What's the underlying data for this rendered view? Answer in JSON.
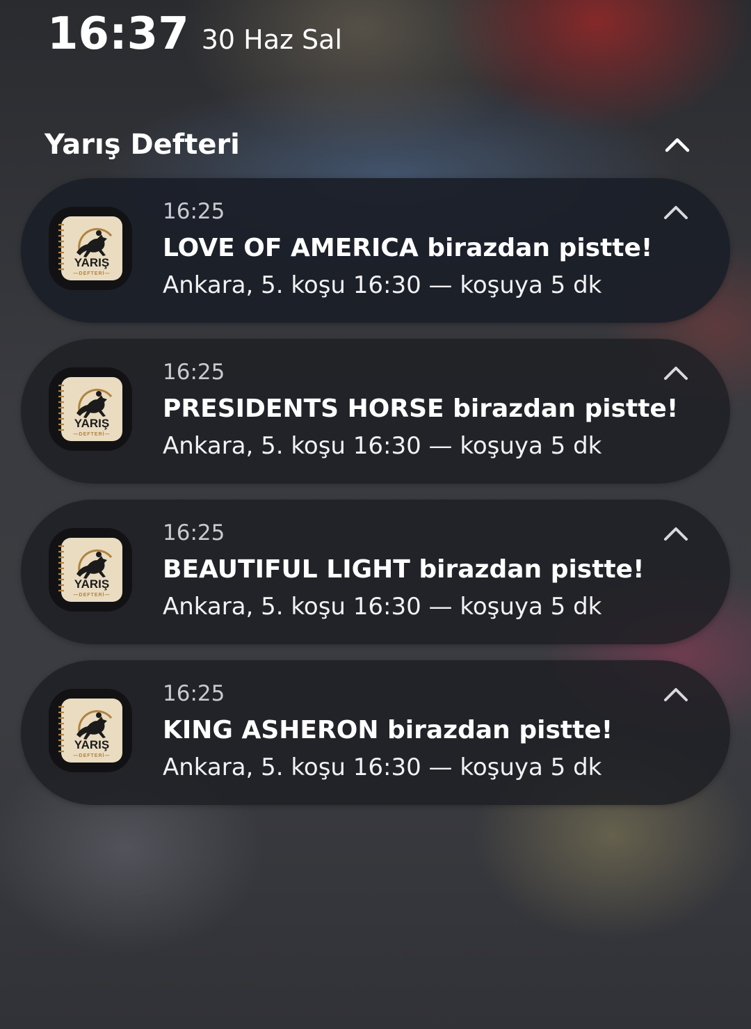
{
  "status": {
    "time": "16:37",
    "date": "30 Haz Sal"
  },
  "group": {
    "title": "Yarış Defteri",
    "icon": "chevron-up-icon"
  },
  "app_icon": {
    "brand": "YARIŞ",
    "sub": "DEFTERİ",
    "colors": {
      "paper": "#e9dcc1",
      "accent": "#b1823f",
      "ink": "#1b1b1b"
    }
  },
  "notifications": [
    {
      "time": "16:25",
      "title": "LOVE OF AMERICA birazdan pistte!",
      "body": "Ankara, 5. koşu 16:30 — koşuya 5 dk"
    },
    {
      "time": "16:25",
      "title": "PRESIDENTS HORSE birazdan pistte!",
      "body": "Ankara, 5. koşu 16:30 — koşuya 5 dk"
    },
    {
      "time": "16:25",
      "title": "BEAUTIFUL LIGHT birazdan pistte!",
      "body": "Ankara, 5. koşu 16:30 — koşuya 5 dk"
    },
    {
      "time": "16:25",
      "title": "KING ASHERON birazdan pistte!",
      "body": "Ankara, 5. koşu 16:30 — koşuya 5 dk"
    }
  ]
}
